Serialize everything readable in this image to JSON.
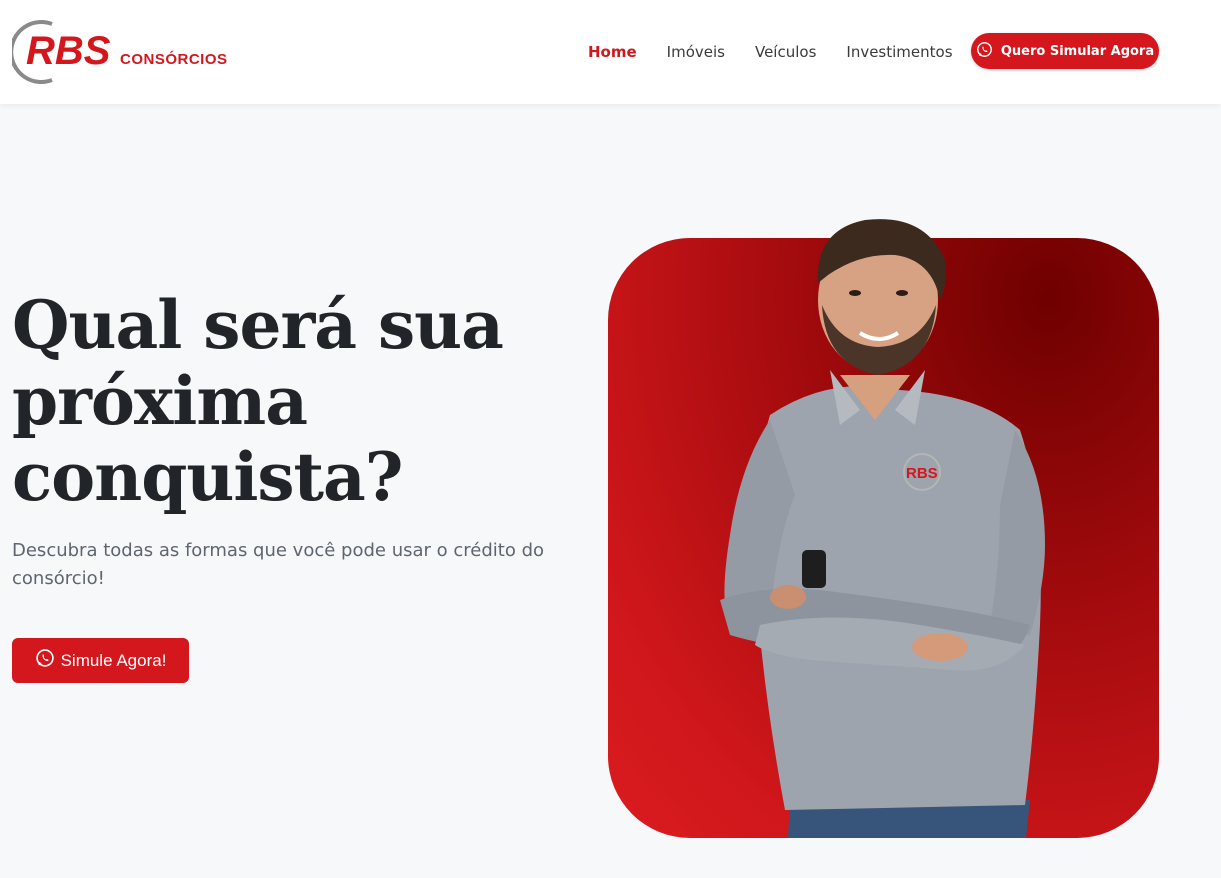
{
  "brand": {
    "logo_main": "RBS",
    "logo_sub": "CONSÓRCIOS",
    "primary_color": "#d4171d",
    "logo_ring_color": "#8a8a8a"
  },
  "nav": {
    "items": [
      {
        "label": "Home",
        "active": true
      },
      {
        "label": "Imóveis",
        "active": false
      },
      {
        "label": "Veículos",
        "active": false
      },
      {
        "label": "Investimentos",
        "active": false
      }
    ],
    "cta_label": "Quero Simular Agora",
    "cta_icon": "whatsapp-icon"
  },
  "hero": {
    "title_lines": [
      "Qual será sua",
      "próxima",
      "conquista?"
    ],
    "subtitle": "Descubra todas as formas que você pode usar o crédito do consórcio!",
    "cta_label": "Simule Agora!",
    "cta_icon": "whatsapp-icon"
  },
  "photo": {
    "shirt_logo": "RBS"
  }
}
